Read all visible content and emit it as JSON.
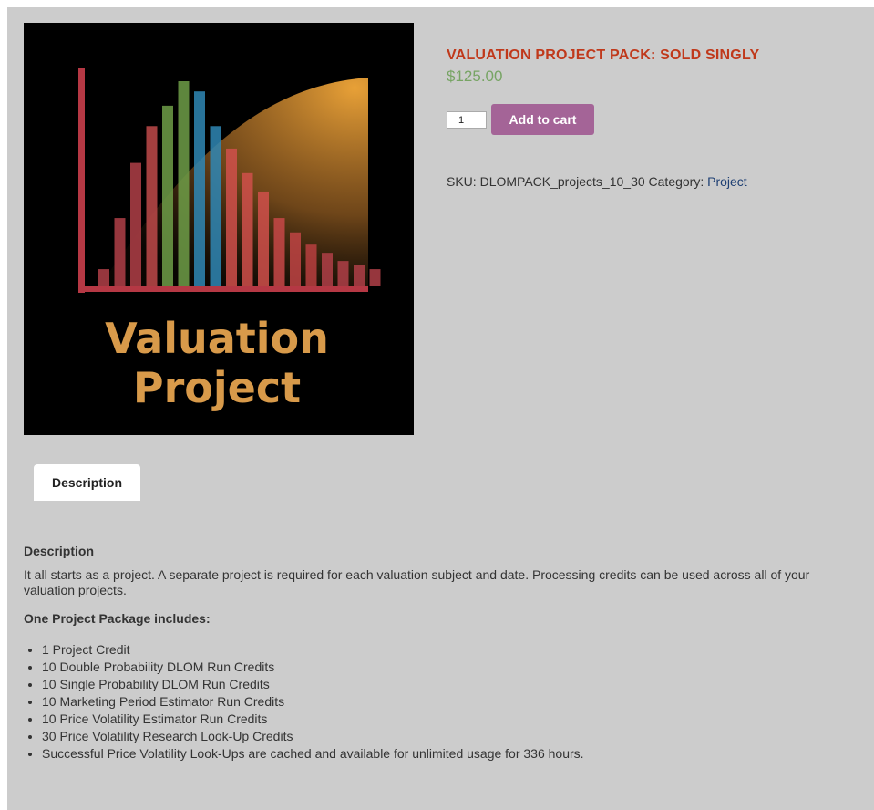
{
  "product": {
    "title": "VALUATION PROJECT PACK: SOLD SINGLY",
    "price": "$125.00",
    "quantity": "1",
    "add_to_cart_label": "Add to cart",
    "sku_label": "SKU:",
    "sku": "DLOMPACK_projects_10_30",
    "category_label": "Category:",
    "category": "Project"
  },
  "image": {
    "line1": "Valuation",
    "line2": "Project",
    "bars": [
      {
        "v": 0.08,
        "c": "#b04048"
      },
      {
        "v": 0.33,
        "c": "#b04048"
      },
      {
        "v": 0.6,
        "c": "#b04048"
      },
      {
        "v": 0.78,
        "c": "#c04a4a"
      },
      {
        "v": 0.88,
        "c": "#6e9e48"
      },
      {
        "v": 1.0,
        "c": "#6e9e48"
      },
      {
        "v": 0.95,
        "c": "#2f87b5"
      },
      {
        "v": 0.78,
        "c": "#2f87b5"
      },
      {
        "v": 0.67,
        "c": "#d0504b"
      },
      {
        "v": 0.55,
        "c": "#d0504b"
      },
      {
        "v": 0.46,
        "c": "#d0504b"
      },
      {
        "v": 0.33,
        "c": "#c84848"
      },
      {
        "v": 0.26,
        "c": "#c04444"
      },
      {
        "v": 0.2,
        "c": "#b84040"
      },
      {
        "v": 0.16,
        "c": "#b04048"
      },
      {
        "v": 0.12,
        "c": "#b04048"
      },
      {
        "v": 0.1,
        "c": "#b04048"
      },
      {
        "v": 0.08,
        "c": "#b04048"
      }
    ],
    "colors": {
      "axis": "#b53844",
      "text": "#d89a4a",
      "curve": "#f0a030"
    }
  },
  "tabs": [
    {
      "label": "Description"
    }
  ],
  "description": {
    "heading": "Description",
    "intro": "It all starts as a project.  A separate project is required for each valuation subject and date.  Processing credits can be used across all of your valuation projects.",
    "package_heading": "One Project Package includes:",
    "items": [
      "1 Project Credit",
      "10 Double Probability DLOM Run Credits",
      "10 Single Probability DLOM Run Credits",
      "10 Marketing Period Estimator Run Credits",
      "10 Price Volatility Estimator Run Credits",
      "30 Price Volatility Research Look-Up Credits",
      "Successful Price Volatility Look-Ups are cached and available for unlimited usage for 336 hours."
    ]
  }
}
